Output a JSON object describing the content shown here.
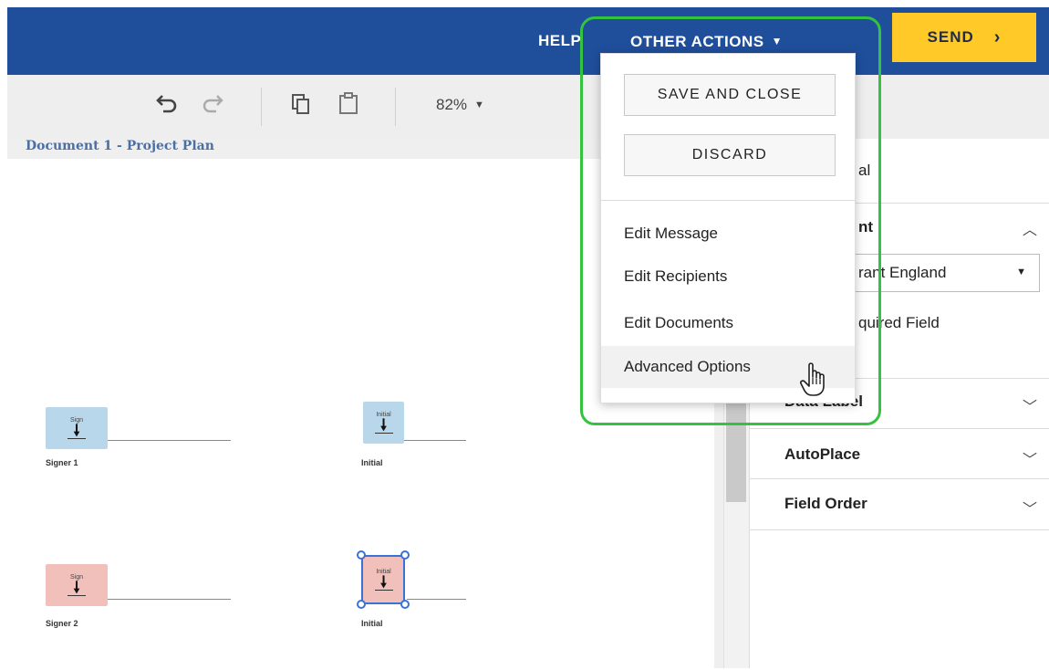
{
  "header": {
    "help_label": "HELP",
    "other_actions_label": "OTHER ACTIONS",
    "send_label": "SEND"
  },
  "toolbar": {
    "zoom_value": "82%"
  },
  "document": {
    "title": "Document 1 - Project Plan",
    "fields": [
      {
        "tag": "Sign",
        "label": "Signer 1",
        "color": "#b9d7ea"
      },
      {
        "tag": "Initial",
        "label": "Initial",
        "color": "#b9d7ea"
      },
      {
        "tag": "Sign",
        "label": "Signer 2",
        "color": "#f2c0bb"
      },
      {
        "tag": "Initial",
        "label": "Initial",
        "color": "#f2c0bb"
      }
    ]
  },
  "right_panel": {
    "partial_1": "al",
    "recipient_heading_partial": "nt",
    "recipient_select_partial": "rant England",
    "required_field_partial": "quired Field",
    "data_label": "Data Label",
    "autoplace": "AutoPlace",
    "field_order": "Field Order"
  },
  "dropdown": {
    "save_and_close": "SAVE AND CLOSE",
    "discard": "DISCARD",
    "items": [
      "Edit Message",
      "Edit Recipients",
      "Edit Documents",
      "Advanced Options"
    ]
  },
  "colors": {
    "header_bg": "#1f4e9b",
    "send_bg": "#ffc928",
    "highlight": "#34c240",
    "selection": "#3a72d8"
  }
}
